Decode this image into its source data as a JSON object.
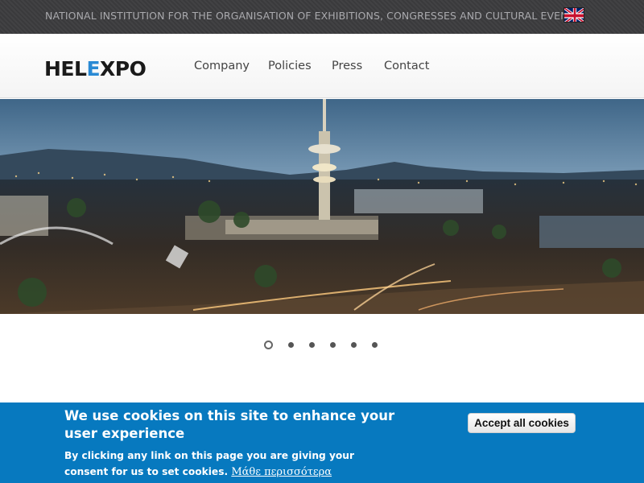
{
  "topbar": {
    "institution_text": "NATIONAL INSTITUTION FOR THE ORGANISATION OF EXHIBITIONS, CONGRESSES AND CULTURAL EVENTS",
    "language_flag_icon": "uk-flag-icon"
  },
  "header": {
    "logo": {
      "part1": "HEL",
      "part2": "E",
      "part3": "XPO"
    },
    "nav": [
      {
        "label": "Company"
      },
      {
        "label": "Policies"
      },
      {
        "label": "Press"
      },
      {
        "label": "Contact"
      }
    ]
  },
  "hero": {
    "image_icon": "city-night-panorama-image"
  },
  "carousel": {
    "slide_count": 6,
    "active_index": 0
  },
  "cookie_banner": {
    "title": "We use cookies on this site to enhance your user experience",
    "body": "By clicking any link on this page you are giving your consent for us to set cookies.",
    "link_text": "Μάθε περισσότερα",
    "accept_label": "Accept all cookies",
    "background_color": "#0779bf"
  }
}
